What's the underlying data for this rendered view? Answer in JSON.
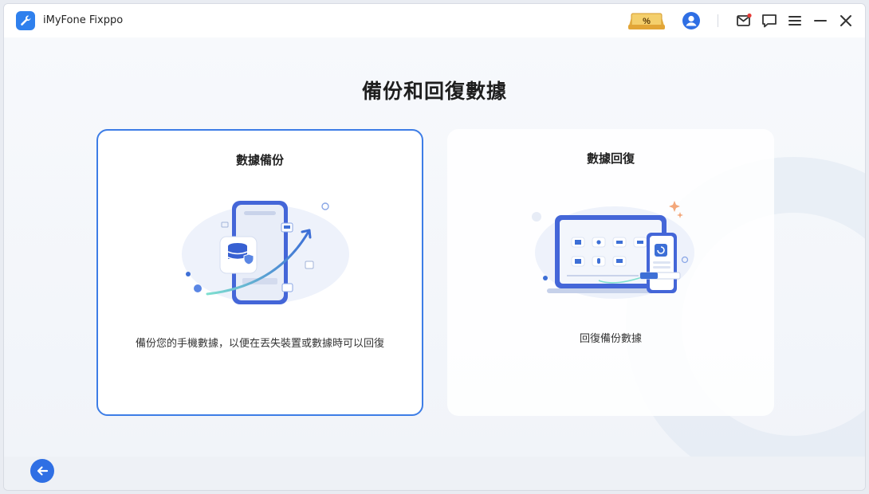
{
  "app": {
    "title": "iMyFone Fixppo",
    "logo_icon": "wrench-icon",
    "accent_color": "#2f6fe4"
  },
  "titlebar": {
    "promo_icon": "discount-coupon-icon",
    "icons": [
      "user-account-icon",
      "mail-icon",
      "feedback-chat-icon",
      "menu-icon",
      "minimize-icon",
      "close-icon"
    ],
    "promo_label": "%"
  },
  "main": {
    "title": "備份和回復數據",
    "cards": [
      {
        "title": "數據備份",
        "description": "備份您的手機數據，以便在丟失裝置或數據時可以回復",
        "selected": true
      },
      {
        "title": "數據回復",
        "description": "回復備份數據",
        "selected": false
      }
    ]
  },
  "footer": {
    "back_icon": "arrow-left-icon"
  }
}
